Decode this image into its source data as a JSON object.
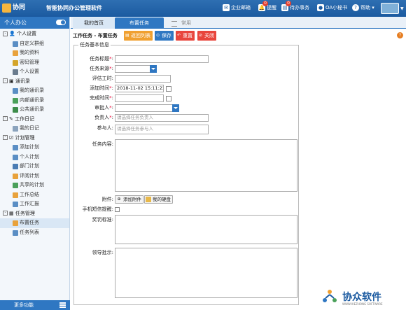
{
  "header": {
    "logo_text": "协同",
    "app_title": "智能协同办公管理软件",
    "buttons": {
      "mail": "企业邮箱",
      "remind": "提醒",
      "remind_count": "0",
      "todo": "待办事务",
      "todo_count": "0",
      "secretary": "OA小秘书",
      "help": "帮助"
    }
  },
  "sidebar": {
    "title": "个人办公",
    "groups": [
      {
        "label": "个人设置",
        "items": [
          "自定义群组",
          "我的资料",
          "密码管理",
          "个人设置"
        ]
      },
      {
        "label": "通讯录",
        "items": [
          "我的通讯录",
          "内部通讯录",
          "公共通讯录"
        ]
      },
      {
        "label": "工作日记",
        "items": [
          "我的日记"
        ]
      },
      {
        "label": "计划管理",
        "items": [
          "添加计划",
          "个人计划",
          "部门计划",
          "评阅计划",
          "共享的计划",
          "工作总结",
          "工作汇报"
        ]
      },
      {
        "label": "任务管理",
        "items": [
          "布置任务",
          "任务列表"
        ]
      }
    ],
    "footer": "更多功能"
  },
  "tabs": [
    "我的首页",
    "布置任务",
    "常用"
  ],
  "toolbar": {
    "page_title": "工作任务 - 布置任务",
    "back": "返回列表",
    "save": "保存",
    "reset": "重置",
    "close": "关闭"
  },
  "form": {
    "legend": "任务基本信息",
    "title_label": "任务标题",
    "source_label": "任务来源",
    "hours_label": "评估工时",
    "add_time_label": "添加时间",
    "add_time_value": "2018-11-02 15:11:23",
    "done_time_label": "完成时间",
    "approver_label": "审批人",
    "owner_label": "负责人",
    "owner_placeholder": "请选择任务负责人",
    "participants_label": "参与人",
    "participants_placeholder": "请选择任务参与人",
    "content_label": "任务内容",
    "attach_label": "附件",
    "add_attachment": "添加附件",
    "my_disk": "我的硬盘",
    "sms_label": "手机短信提醒",
    "reward_label": "奖罚标准",
    "leader_label": "领导批示"
  },
  "watermark": {
    "title": "协众软件",
    "subtitle": "WWW.XIEZHONG SOFTWARE"
  },
  "colors": {
    "header": "#1b5aa0",
    "accent": "#2f77c2",
    "back_btn": "#f0a030",
    "save_btn": "#2f77c2",
    "reset_btn": "#e8453c",
    "close_btn": "#e8453c",
    "required": "#e00033"
  }
}
